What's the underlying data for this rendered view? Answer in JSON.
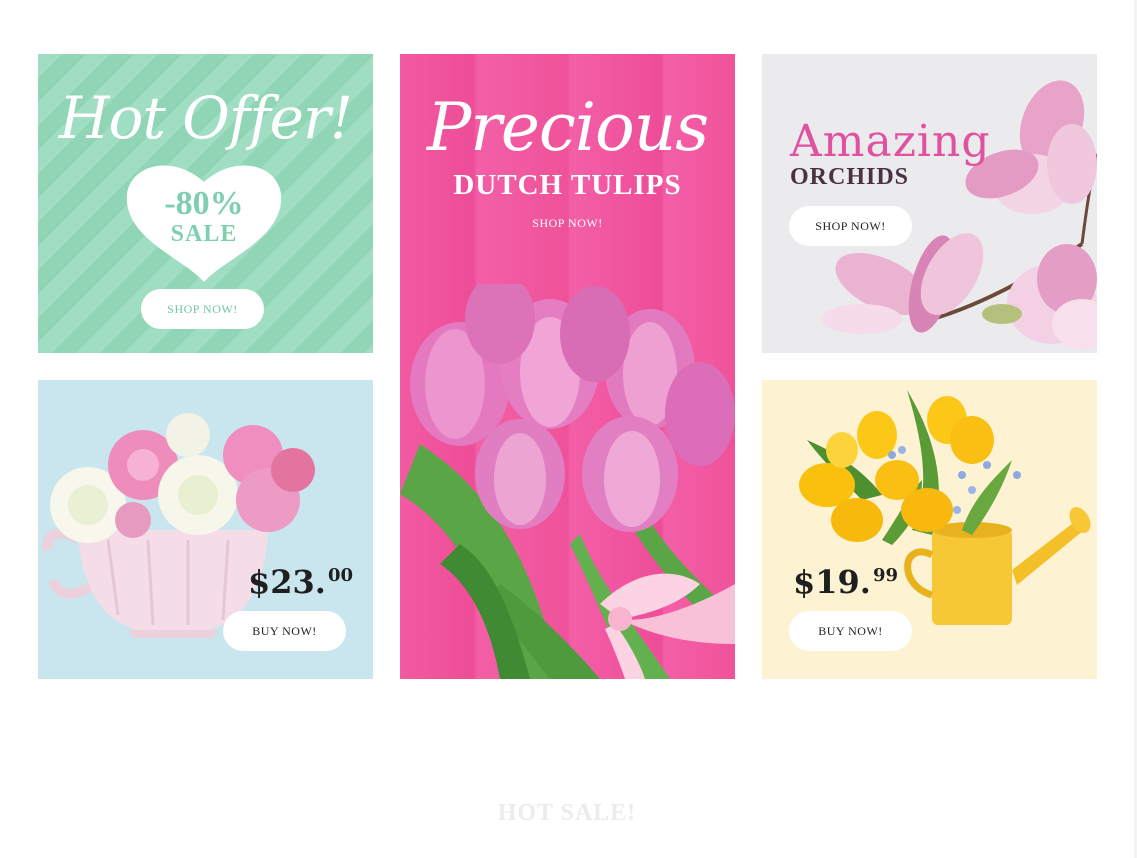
{
  "hot_offer": {
    "title": "Hot Offer!",
    "discount": "-80%",
    "sale_label": "SALE",
    "button": "SHOP NOW!"
  },
  "tulips": {
    "title": "Precious",
    "subtitle": "DUTCH TULIPS",
    "button": "SHOP NOW!"
  },
  "orchids": {
    "title": "Amazing",
    "subtitle": "ORCHIDS",
    "button": "SHOP NOW!"
  },
  "ranunculus": {
    "price_dollars": "$23.",
    "price_cents": "00",
    "button": "BUY NOW!"
  },
  "yellow_tulips": {
    "price_dollars": "$19.",
    "price_cents": "99",
    "button": "BUY NOW!"
  },
  "footer": {
    "heading": "HOT SALE!"
  },
  "colors": {
    "mint": "#9fdec2",
    "pink": "#ef5299",
    "orchid_pink": "#e0519f",
    "light_blue": "#c9e6ef",
    "cream": "#fdf3d3"
  }
}
